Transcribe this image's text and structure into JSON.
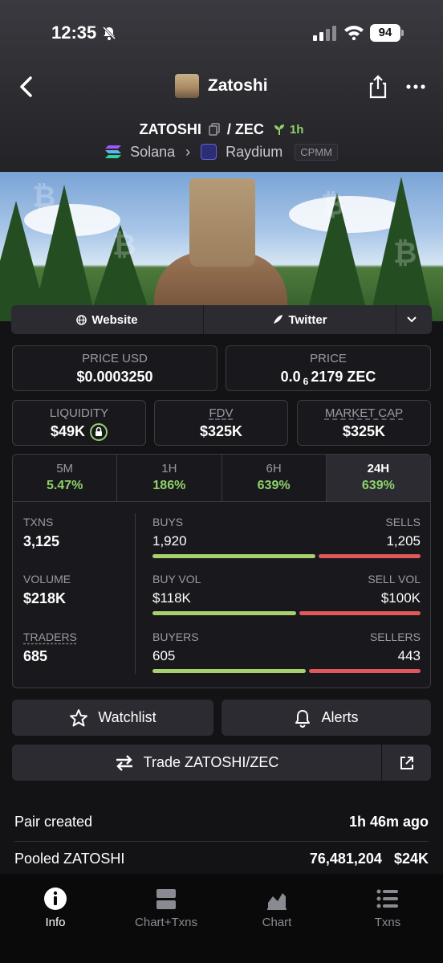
{
  "status_bar": {
    "time": "12:35",
    "battery": "94"
  },
  "header": {
    "title": "Zatoshi"
  },
  "pair": {
    "base": "ZATOSHI",
    "separator": "/",
    "quote": "ZEC",
    "age": "1h"
  },
  "chain": {
    "network": "Solana",
    "dex": "Raydium",
    "pool_type": "CPMM"
  },
  "links": {
    "website": "Website",
    "twitter": "Twitter"
  },
  "price": {
    "usd_label": "PRICE USD",
    "usd_value": "$0.0003250",
    "native_label": "PRICE",
    "native_prefix": "0.0",
    "native_zeros": "6",
    "native_digits": "2179 ZEC"
  },
  "metrics": {
    "liquidity_label": "LIQUIDITY",
    "liquidity_value": "$49K",
    "fdv_label": "FDV",
    "fdv_value": "$325K",
    "mcap_label": "MARKET CAP",
    "mcap_value": "$325K"
  },
  "timeframes": [
    {
      "label": "5M",
      "change": "5.47%"
    },
    {
      "label": "1H",
      "change": "186%"
    },
    {
      "label": "6H",
      "change": "639%"
    },
    {
      "label": "24H",
      "change": "639%"
    }
  ],
  "stats": {
    "txns_label": "TXNS",
    "txns_value": "3,125",
    "buys_label": "BUYS",
    "buys_value": "1,920",
    "sells_label": "SELLS",
    "sells_value": "1,205",
    "volume_label": "VOLUME",
    "volume_value": "$218K",
    "buy_vol_label": "BUY VOL",
    "buy_vol_value": "$118K",
    "sell_vol_label": "SELL VOL",
    "sell_vol_value": "$100K",
    "traders_label": "TRADERS",
    "traders_value": "685",
    "buyers_label": "BUYERS",
    "buyers_value": "605",
    "sellers_label": "SELLERS",
    "sellers_value": "443"
  },
  "ratios": {
    "buys": 0.614,
    "buy_vol": 0.541,
    "buyers": 0.577
  },
  "actions": {
    "watchlist": "Watchlist",
    "alerts": "Alerts",
    "trade": "Trade ZATOSHI/ZEC"
  },
  "info": {
    "pair_created_label": "Pair created",
    "pair_created_value": "1h 46m ago",
    "pooled_label": "Pooled ZATOSHI",
    "pooled_amount": "76,481,204",
    "pooled_usd": "$24K"
  },
  "nav": [
    {
      "label": "Info",
      "icon": "info-icon"
    },
    {
      "label": "Chart+Txns",
      "icon": "chart-txns-icon"
    },
    {
      "label": "Chart",
      "icon": "chart-icon"
    },
    {
      "label": "Txns",
      "icon": "list-icon"
    }
  ],
  "colors": {
    "positive": "#8fd16a",
    "buy_bar": "#a6d26e",
    "sell_bar": "#e0585a",
    "background": "#131316"
  }
}
